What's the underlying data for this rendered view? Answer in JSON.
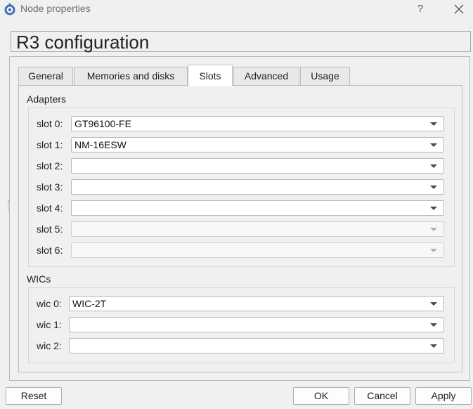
{
  "window": {
    "title": "Node properties",
    "help": "?"
  },
  "config_title": "R3 configuration",
  "tabs": [
    {
      "label": "General"
    },
    {
      "label": "Memories and disks"
    },
    {
      "label": "Slots"
    },
    {
      "label": "Advanced"
    },
    {
      "label": "Usage"
    }
  ],
  "active_tab": "Slots",
  "adapters": {
    "group_label": "Adapters",
    "slots": [
      {
        "label": "slot 0:",
        "value": "GT96100-FE",
        "enabled": true
      },
      {
        "label": "slot 1:",
        "value": "NM-16ESW",
        "enabled": true
      },
      {
        "label": "slot 2:",
        "value": "",
        "enabled": true
      },
      {
        "label": "slot 3:",
        "value": "",
        "enabled": true
      },
      {
        "label": "slot 4:",
        "value": "",
        "enabled": true
      },
      {
        "label": "slot 5:",
        "value": "",
        "enabled": false
      },
      {
        "label": "slot 6:",
        "value": "",
        "enabled": false
      }
    ]
  },
  "wics": {
    "group_label": "WICs",
    "slots": [
      {
        "label": "wic 0:",
        "value": "WIC-2T",
        "enabled": true
      },
      {
        "label": "wic 1:",
        "value": "",
        "enabled": true
      },
      {
        "label": "wic 2:",
        "value": "",
        "enabled": true
      }
    ]
  },
  "buttons": {
    "reset": "Reset",
    "ok": "OK",
    "cancel": "Cancel",
    "apply": "Apply"
  },
  "colors": {
    "panel_bg": "#f0f0f0",
    "active_tab_bg": "#ffffff",
    "border": "#bdbdbd"
  },
  "icons": {
    "app": "gns3-app-icon",
    "close": "close-icon",
    "dropdown": "chevron-down-icon"
  }
}
